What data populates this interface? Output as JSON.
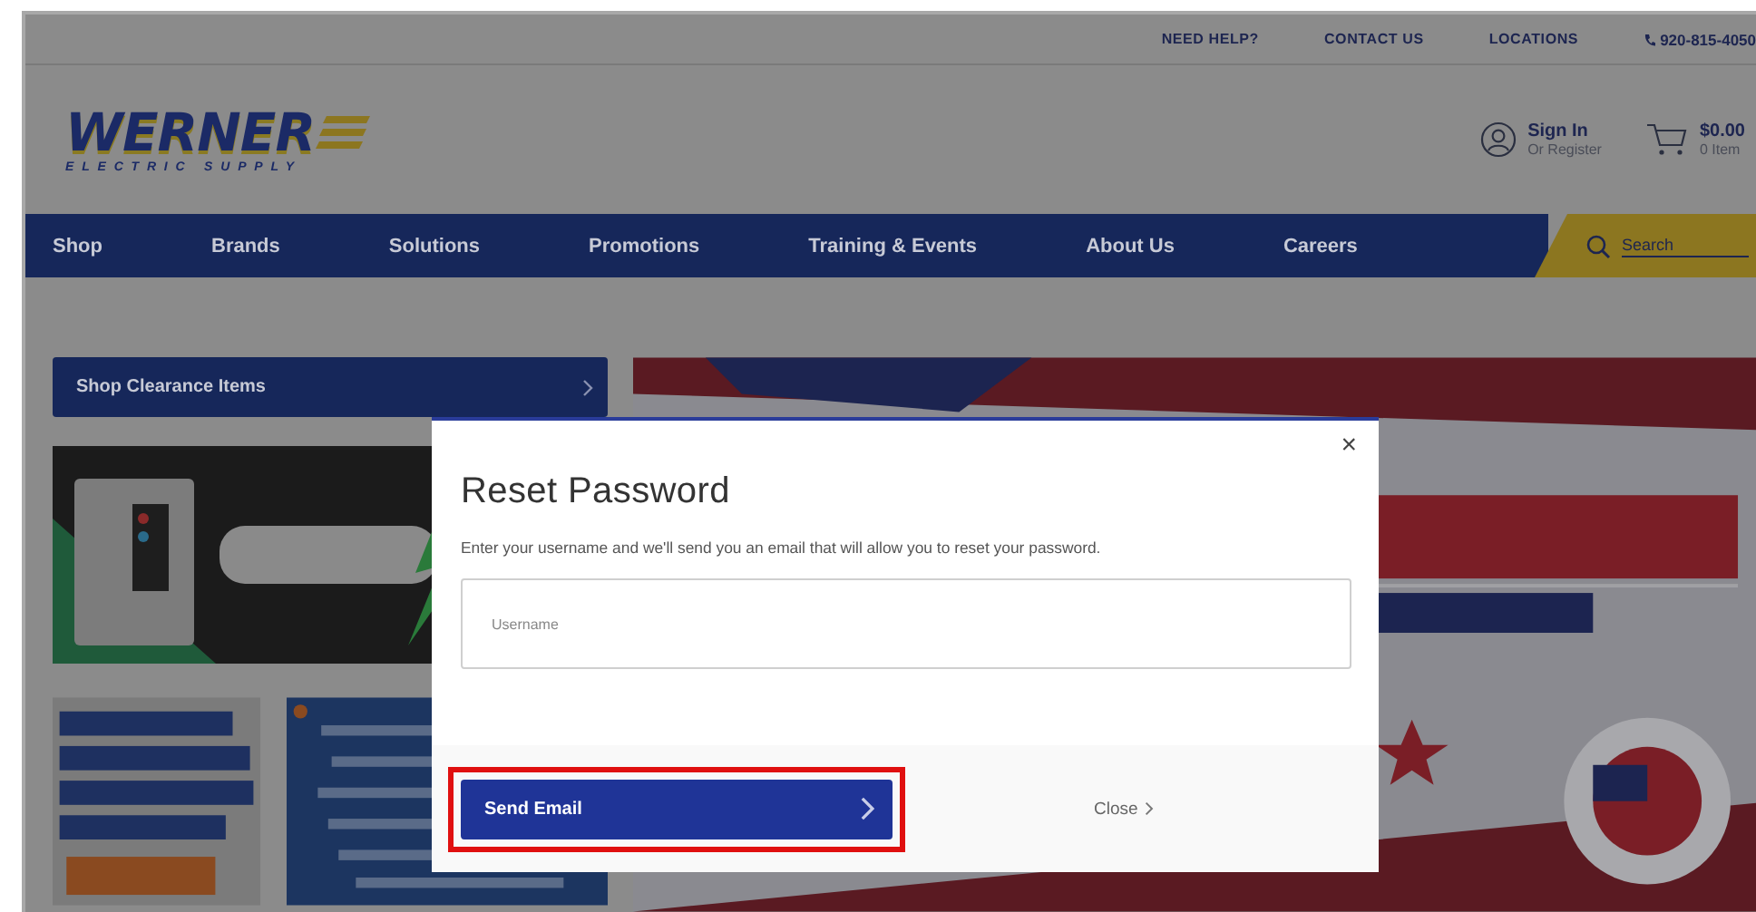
{
  "top_bar": {
    "links": [
      "NEED HELP?",
      "CONTACT US",
      "LOCATIONS"
    ],
    "phone": "920-815-4050"
  },
  "logo": {
    "name": "WERNER",
    "tagline": "ELECTRIC SUPPLY"
  },
  "account": {
    "title": "Sign In",
    "subtitle": "Or Register"
  },
  "cart": {
    "total": "$0.00",
    "items": "0 Item"
  },
  "nav": {
    "items": [
      "Shop",
      "Brands",
      "Solutions",
      "Promotions",
      "Training & Events",
      "About Us",
      "Careers"
    ],
    "search_placeholder": "Search"
  },
  "clearance_link": {
    "label": "Shop Clearance Items"
  },
  "dialog": {
    "title": "Reset Password",
    "close_glyph": "×",
    "description": "Enter your username and we'll send you an email that will allow you to reset your password.",
    "field": {
      "placeholder": "Username"
    },
    "send_button": {
      "label": "Send Email",
      "highlighted": true
    },
    "close_link": "Close"
  }
}
